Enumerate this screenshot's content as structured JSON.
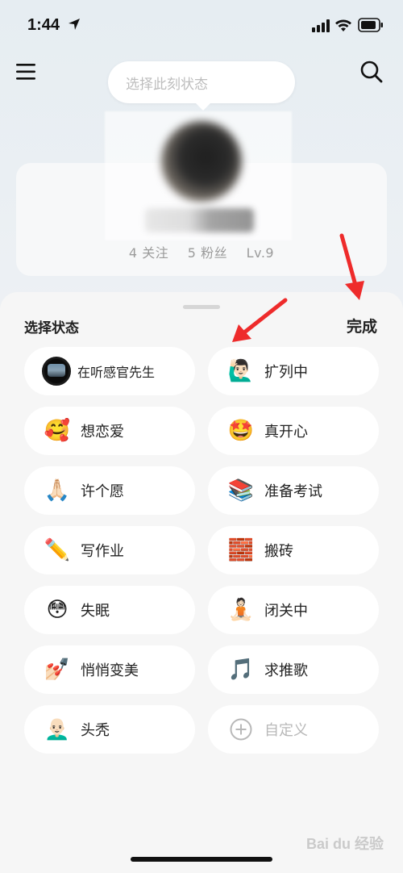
{
  "status_bar": {
    "time": "1:44"
  },
  "header": {
    "status_placeholder": "选择此刻状态"
  },
  "profile": {
    "follow": "4 关注",
    "fans": "5 粉丝",
    "level": "Lv.9"
  },
  "sheet": {
    "title": "选择状态",
    "done": "完成",
    "items": [
      {
        "label": "在听感官先生",
        "icon": "music-cover-avatar",
        "emoji": ""
      },
      {
        "label": "扩列中",
        "icon": "raising-hand-person-icon",
        "emoji": "🙋🏻‍♂️"
      },
      {
        "label": "想恋爱",
        "icon": "smiling-hearts-face-icon",
        "emoji": "🥰"
      },
      {
        "label": "真开心",
        "icon": "star-struck-face-icon",
        "emoji": "🤩"
      },
      {
        "label": "许个愿",
        "icon": "folded-hands-icon",
        "emoji": "🙏🏻"
      },
      {
        "label": "准备考试",
        "icon": "books-icon",
        "emoji": "📚"
      },
      {
        "label": "写作业",
        "icon": "pencil-icon",
        "emoji": "✏️"
      },
      {
        "label": "搬砖",
        "icon": "bricks-icon",
        "emoji": "🧱"
      },
      {
        "label": "失眠",
        "icon": "flushed-face-icon",
        "emoji": "😳"
      },
      {
        "label": "闭关中",
        "icon": "meditating-person-icon",
        "emoji": "🧘🏻"
      },
      {
        "label": "悄悄变美",
        "icon": "nail-polish-icon",
        "emoji": "💅🏻"
      },
      {
        "label": "求推歌",
        "icon": "music-note-icon",
        "emoji": "🎵"
      },
      {
        "label": "头秃",
        "icon": "bald-man-face-icon",
        "emoji": "👨🏻‍🦲"
      },
      {
        "label": "自定义",
        "icon": "add-circle-icon",
        "emoji": ""
      }
    ]
  },
  "watermark": {
    "text": "Bai du 经验"
  },
  "colors": {
    "arrow": "#ee2b2b",
    "sheet_bg": "#f6f6f6",
    "chip_bg": "#ffffff"
  }
}
